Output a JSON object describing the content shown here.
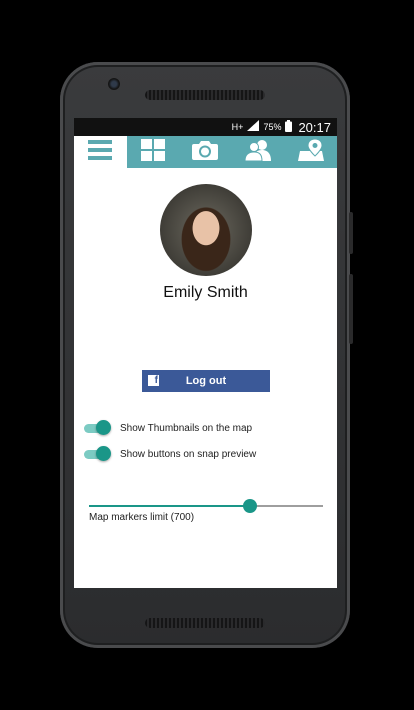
{
  "status_bar": {
    "network": "H+",
    "battery": "75%",
    "time": "20:17"
  },
  "nav": {
    "tabs": [
      {
        "icon": "menu-icon",
        "active": true
      },
      {
        "icon": "grid-icon",
        "active": false
      },
      {
        "icon": "camera-icon",
        "active": false
      },
      {
        "icon": "people-icon",
        "active": false
      },
      {
        "icon": "map-marker-icon",
        "active": false
      }
    ],
    "bar_color": "#5aa9b0"
  },
  "profile": {
    "name": "Emily Smith"
  },
  "logout": {
    "label": "Log out",
    "color": "#3b5998"
  },
  "settings": {
    "toggles": [
      {
        "label": "Show Thumbnails on the map",
        "on": true
      },
      {
        "label": "Show buttons on snap preview",
        "on": true
      }
    ],
    "markers": {
      "label": "Map markers limit (700)",
      "fraction": 0.69
    },
    "accent_color": "#1a9688"
  }
}
